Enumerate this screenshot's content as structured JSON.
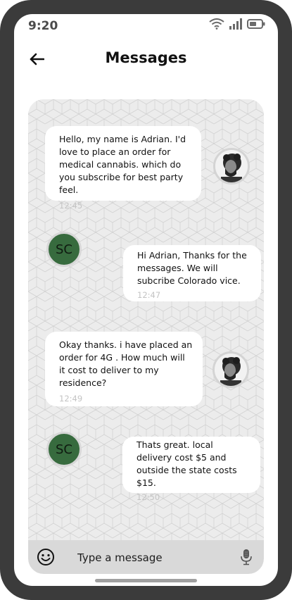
{
  "status_bar": {
    "time": "9:20",
    "icons": [
      "wifi-icon",
      "signal-icon",
      "battery-icon"
    ]
  },
  "header": {
    "title": "Messages",
    "back_icon": "arrow-left-icon"
  },
  "messages": [
    {
      "sender": "Adrian",
      "side": "left",
      "text": "Hello, my name is Adrian. I'd love to place an order for medical cannabis. which do you subscribe for best party feel.",
      "time": "12:45",
      "avatar": "photo"
    },
    {
      "sender": "SC",
      "side": "right",
      "text": "Hi Adrian, Thanks for the messages. We will subcribe Colorado vice.",
      "time": "12:47",
      "avatar_initials": "SC"
    },
    {
      "sender": "Adrian",
      "side": "left",
      "text": "Okay thanks. i have placed an order for 4G . How much will it cost to deliver to my residence?",
      "time": "12:49",
      "avatar": "photo"
    },
    {
      "sender": "SC",
      "side": "right",
      "text": "Thats great. local delivery cost $5 and outside the state costs $15.",
      "time": "12:50",
      "avatar_initials": "SC"
    }
  ],
  "composer": {
    "placeholder": "Type a message",
    "emoji_icon": "smiley-icon",
    "mic_icon": "microphone-icon"
  },
  "colors": {
    "avatar_green": "#376b3e",
    "timestamp": "#c4c4c4",
    "frame": "#3b3b3b",
    "chat_bg": "#ececec",
    "composer_bg": "#d9d9d9"
  }
}
